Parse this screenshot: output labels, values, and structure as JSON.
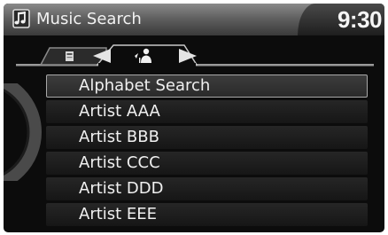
{
  "header": {
    "title": "Music Search",
    "clock": "9:30",
    "icon": "music-note-icon"
  },
  "tabs": {
    "left_tab_icon": "hdd-icon",
    "active_tab_icon": "artist-person-icon",
    "prev_icon": "arrow-left-icon",
    "next_icon": "arrow-right-icon"
  },
  "list": {
    "items": [
      {
        "label": "Alphabet Search",
        "selected": true
      },
      {
        "label": "Artist AAA",
        "selected": false
      },
      {
        "label": "Artist BBB",
        "selected": false
      },
      {
        "label": "Artist CCC",
        "selected": false
      },
      {
        "label": "Artist DDD",
        "selected": false
      },
      {
        "label": "Artist EEE",
        "selected": false
      }
    ]
  }
}
